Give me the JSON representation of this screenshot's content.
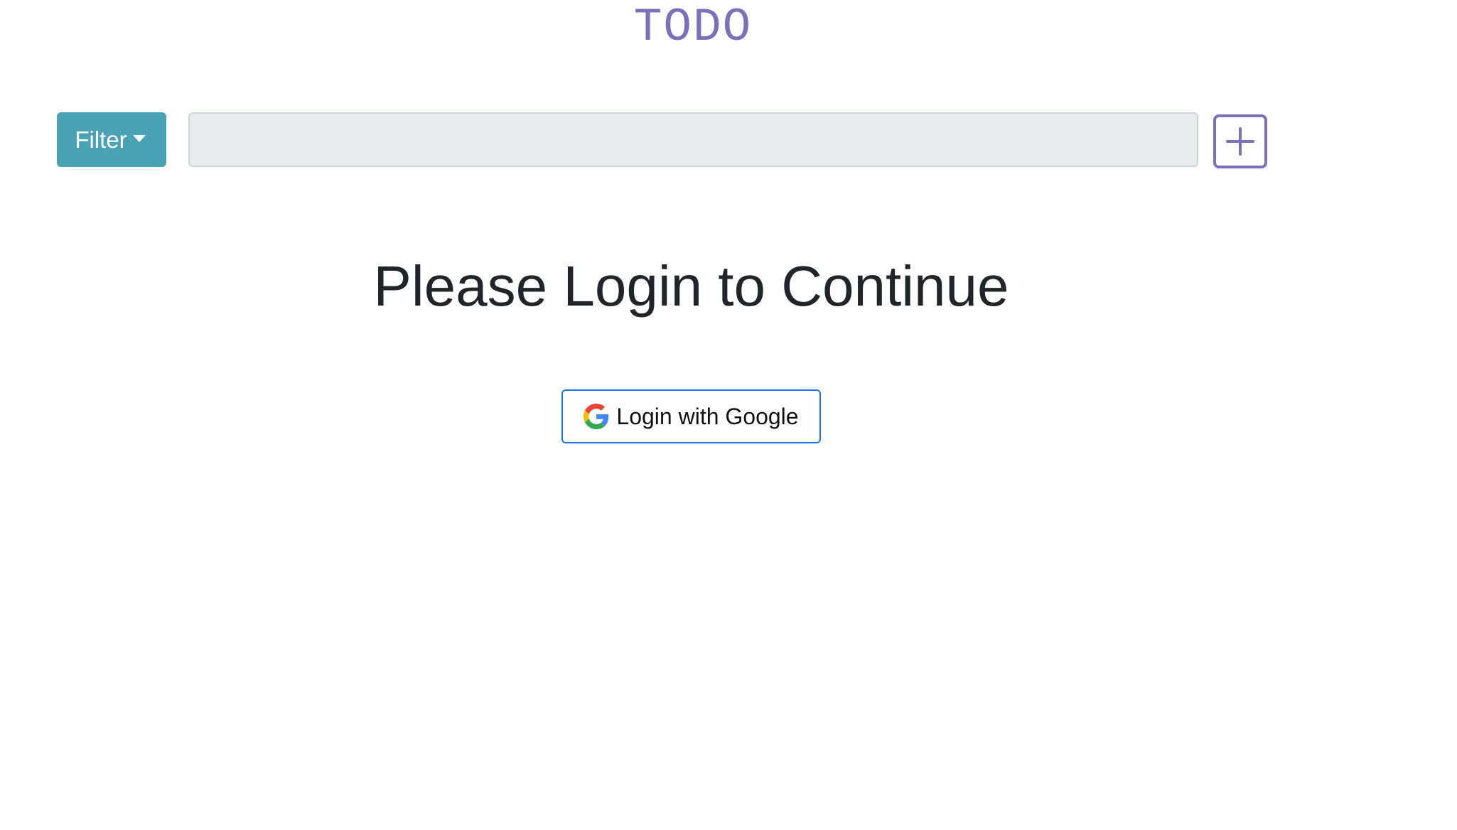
{
  "app": {
    "title": "TODO"
  },
  "toolbar": {
    "filter_label": "Filter",
    "task_input_value": "",
    "task_input_placeholder": "",
    "add_icon": "plus-square-icon"
  },
  "main": {
    "heading": "Please Login to Continue",
    "login_button_label": "Login with Google",
    "login_icon": "google-icon"
  },
  "colors": {
    "accent": "#7d70ba",
    "filter_button": "#4aa3b5",
    "input_background": "#e9ecef",
    "login_border": "#1a73e8",
    "heading_text": "#212529"
  }
}
